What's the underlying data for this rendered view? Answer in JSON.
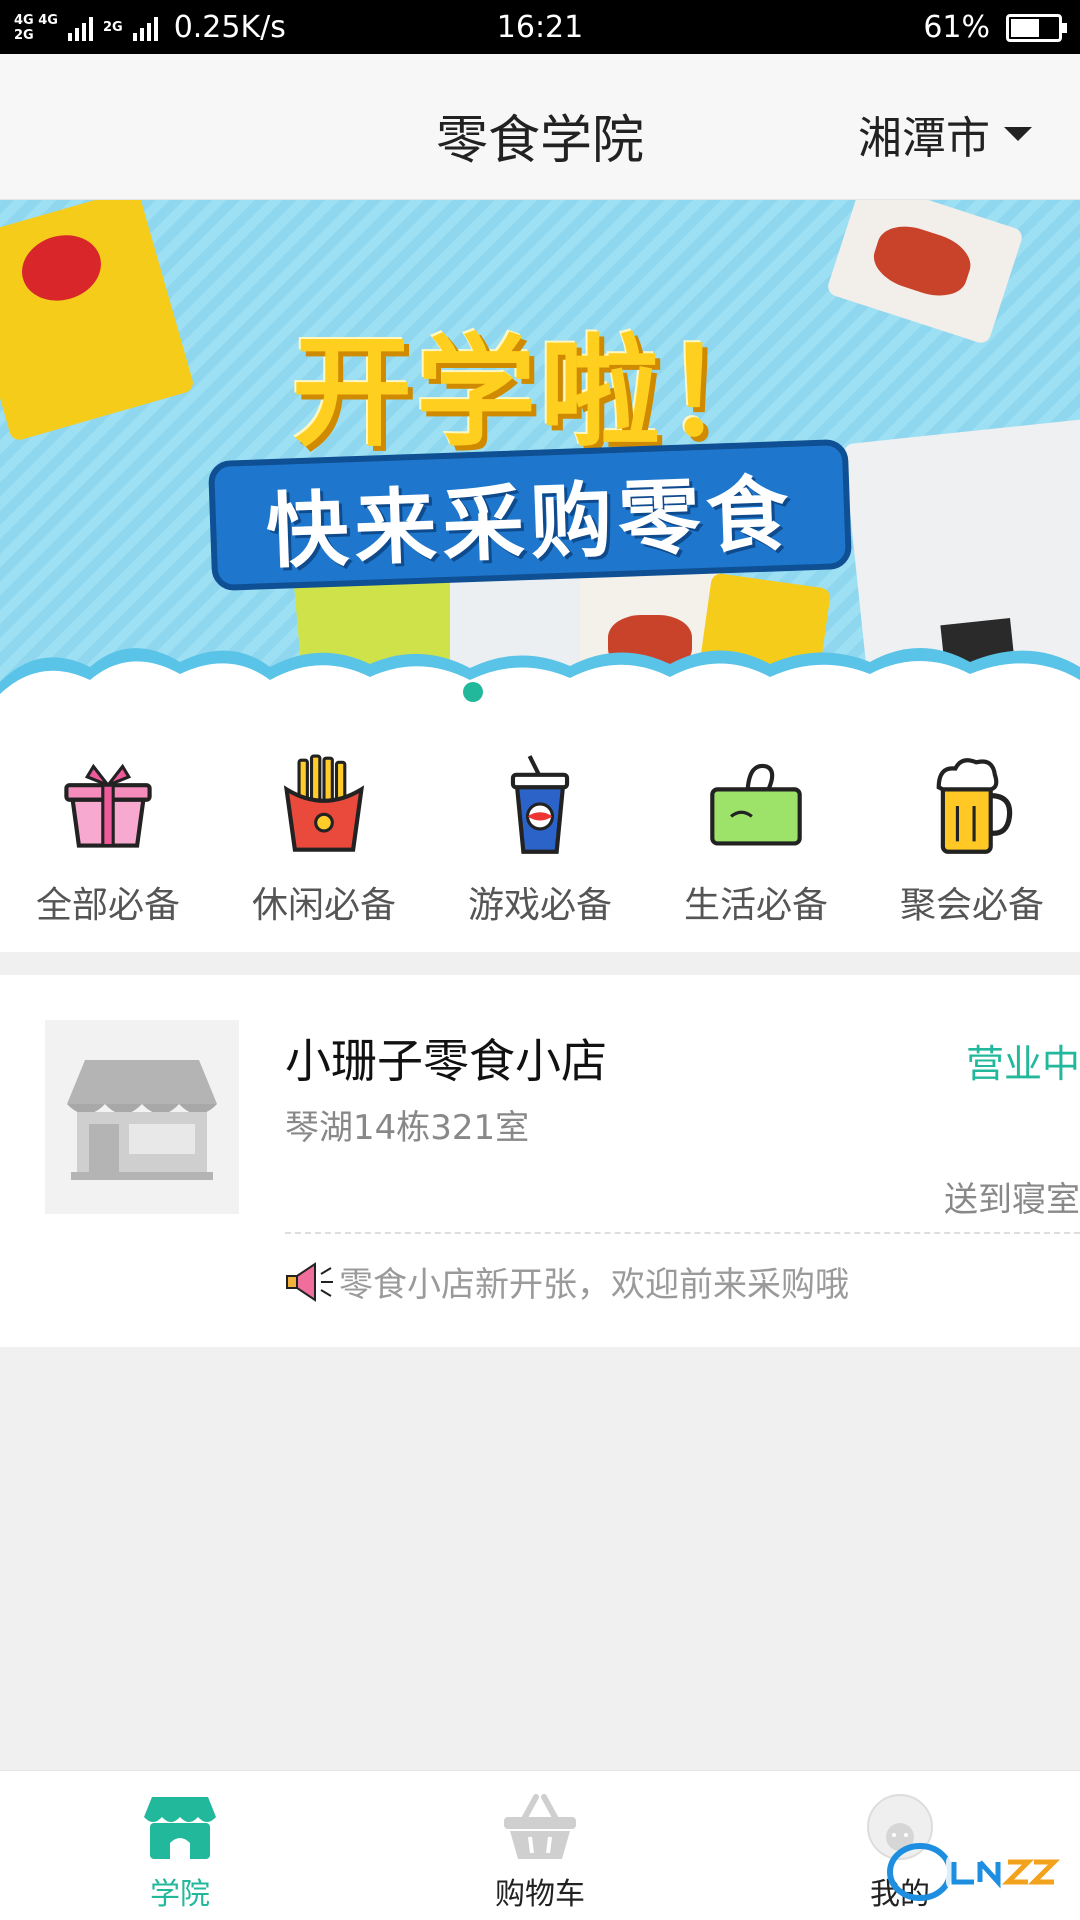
{
  "status_bar": {
    "net_top": "4G 4G",
    "net_bottom": "2G",
    "net_small": "2G",
    "speed": "0.25K/s",
    "time": "16:21",
    "battery_text": "61%",
    "battery_level": 0.61
  },
  "header": {
    "title": "零食学院",
    "city": "湘潭市"
  },
  "banner": {
    "headline": "开学啦！",
    "ribbon": "快来采购零食",
    "active_index": 0,
    "page_count": 1
  },
  "categories": [
    {
      "label": "全部必备",
      "icon": "gift-basket-icon"
    },
    {
      "label": "休闲必备",
      "icon": "fries-icon"
    },
    {
      "label": "游戏必备",
      "icon": "soda-cup-icon"
    },
    {
      "label": "生活必备",
      "icon": "tissue-box-icon"
    },
    {
      "label": "聚会必备",
      "icon": "beer-mug-icon"
    }
  ],
  "store": {
    "name": "小珊子零食小店",
    "status": "营业中",
    "address": "琴湖14栋321室",
    "delivery": "送到寝室",
    "notice": "零食小店新开张，欢迎前来采购哦"
  },
  "tabs": [
    {
      "label": "学院",
      "icon": "storefront-icon",
      "active": true
    },
    {
      "label": "购物车",
      "icon": "basket-icon",
      "active": false
    },
    {
      "label": "我的",
      "icon": "avatar-icon",
      "active": false
    }
  ],
  "colors": {
    "accent": "#22b89b",
    "banner_sky": "#8fd7ef",
    "headline_yellow": "#ffcf1f",
    "ribbon_blue": "#1e77cc"
  }
}
